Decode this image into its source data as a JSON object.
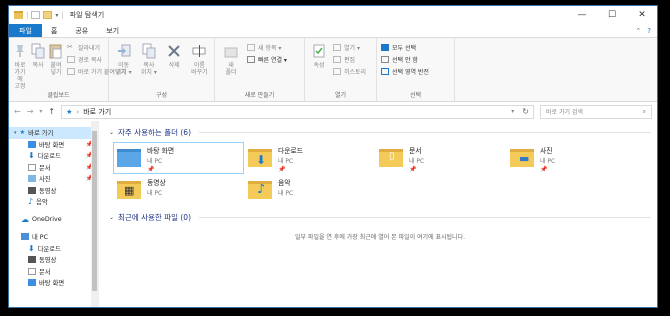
{
  "window": {
    "title": "파일 탐색기",
    "min_glyph": "—",
    "max_glyph": "☐",
    "close_glyph": "✕"
  },
  "tabs": [
    "파일",
    "홈",
    "공유",
    "보기"
  ],
  "ribbon": {
    "clipboard": {
      "label": "클립보드",
      "pin": "바로 가기에\n고정",
      "copy": "복사",
      "paste": "붙여넣기",
      "cut": "잘라내기",
      "copy_path": "경로 복사",
      "paste_shortcut": "바로 가기 붙여넣기"
    },
    "organize": {
      "label": "구성",
      "move_to": "이동\n위치 ▾",
      "copy_to": "복사\n위치 ▾",
      "delete": "삭제",
      "rename": "이름\n바꾸기"
    },
    "new": {
      "label": "새로 만들기",
      "new_folder": "새\n폴더",
      "new_item": "새 항목 ▾",
      "easy_access": "빠른 연결 ▾"
    },
    "open": {
      "label": "열기",
      "properties": "속성",
      "open": "열기 ▾",
      "edit": "편집",
      "history": "히스토리"
    },
    "select": {
      "label": "선택",
      "select_all": "모두 선택",
      "select_none": "선택 안 함",
      "invert": "선택 영역 반전"
    }
  },
  "address": {
    "path": "바로 가기",
    "search_placeholder": "바로 가기 검색"
  },
  "nav_pane": {
    "quick_access": "바로 가기",
    "quick_items": [
      "바탕 화면",
      "다운로드",
      "문서",
      "사진",
      "동영상",
      "음악"
    ],
    "onedrive": "OneDrive",
    "this_pc": "내 PC",
    "pc_items": [
      "다운로드",
      "동영상",
      "문서",
      "바탕 화면"
    ]
  },
  "frequent": {
    "header": "자주 사용하는 폴더 (6)",
    "folders": [
      {
        "name": "바탕 화면",
        "loc": "내 PC",
        "pin": "📌"
      },
      {
        "name": "다운로드",
        "loc": "내 PC",
        "pin": "📌"
      },
      {
        "name": "문서",
        "loc": "내 PC",
        "pin": "📌"
      },
      {
        "name": "사진",
        "loc": "내 PC",
        "pin": "📌"
      },
      {
        "name": "동영상",
        "loc": "내 PC",
        "pin": ""
      },
      {
        "name": "음악",
        "loc": "내 PC",
        "pin": ""
      }
    ]
  },
  "recent": {
    "header": "최근에 사용한 파일 (0)",
    "empty_text": "일부 파일을 연 후에 가장 최근에 열어 본 파일이 여기에 표시됩니다."
  },
  "colors": {
    "accent": "#1979ca",
    "folder": "#f4cb58",
    "selection": "#cce8ff"
  }
}
